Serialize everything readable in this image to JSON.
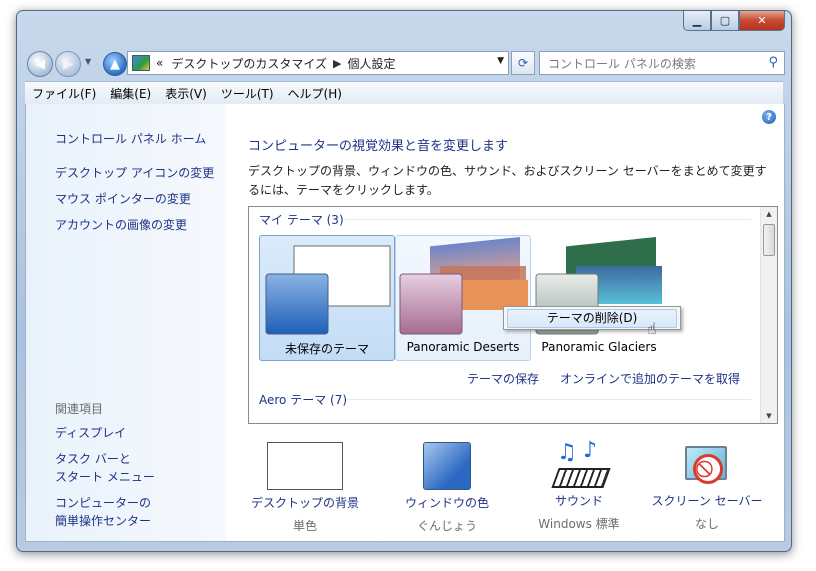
{
  "window": {
    "caption_buttons": [
      "minimize-icon",
      "maximize-icon",
      "close-icon"
    ]
  },
  "nav": {
    "address_prefix": "«",
    "breadcrumb": [
      "デスクトップのカスタマイズ",
      "個人設定"
    ],
    "search_placeholder": "コントロール パネルの検索"
  },
  "menu": [
    "ファイル(F)",
    "編集(E)",
    "表示(V)",
    "ツール(T)",
    "ヘルプ(H)"
  ],
  "sidebar": {
    "home": "コントロール パネル ホーム",
    "links": [
      "デスクトップ アイコンの変更",
      "マウス ポインターの変更",
      "アカウントの画像の変更"
    ],
    "related_header": "関連項目",
    "related": [
      "ディスプレイ",
      "タスク バーと\nスタート メニュー",
      "コンピューターの\n簡単操作センター"
    ]
  },
  "main": {
    "title": "コンピューターの視覚効果と音を変更します",
    "description": "デスクトップの背景、ウィンドウの色、サウンド、およびスクリーン セーバーをまとめて変更するには、テーマをクリックします。",
    "my_themes": "マイ テーマ (3)",
    "themes": [
      "未保存のテーマ",
      "Panoramic Deserts",
      "Panoramic Glaciers"
    ],
    "context_menu_item": "テーマの削除(D)",
    "save_theme": "テーマの保存",
    "get_more": "オンラインで追加のテーマを取得",
    "aero_themes": "Aero テーマ (7)"
  },
  "bottom": [
    {
      "label": "デスクトップの背景",
      "sub": "単色"
    },
    {
      "label": "ウィンドウの色",
      "sub": "ぐんじょう"
    },
    {
      "label": "サウンド",
      "sub": "Windows 標準"
    },
    {
      "label": "スクリーン セーバー",
      "sub": "なし"
    }
  ],
  "colors": {
    "link": "#1e3287",
    "accent": "#7da2ce"
  }
}
